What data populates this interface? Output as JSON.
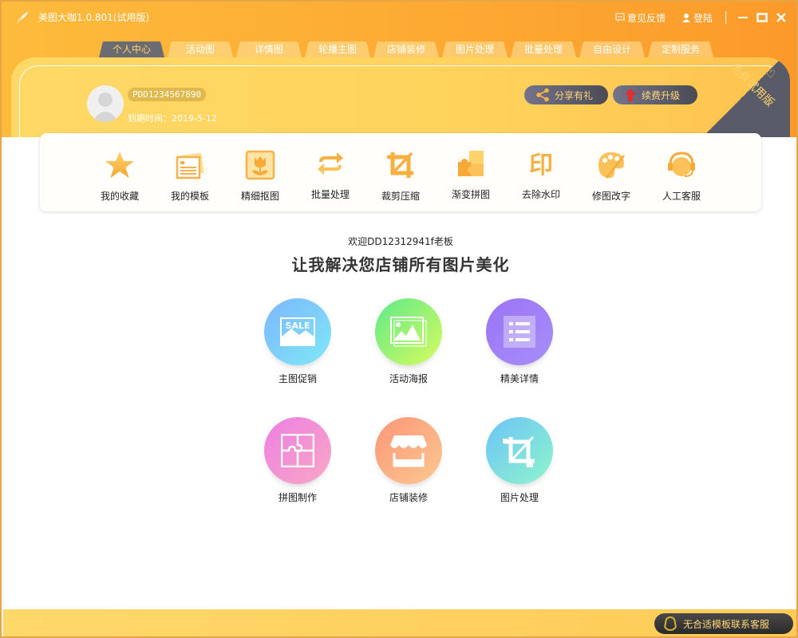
{
  "app": {
    "title": "美图大咖1.0.801(试用版)",
    "feedback_label": "意见反馈",
    "login_label": "登陆"
  },
  "tabs": [
    {
      "label": "个人中心",
      "active": true
    },
    {
      "label": "活动图",
      "active": false
    },
    {
      "label": "详情图",
      "active": false
    },
    {
      "label": "轮播主图",
      "active": false
    },
    {
      "label": "店铺装修",
      "active": false
    },
    {
      "label": "图片处理",
      "active": false
    },
    {
      "label": "批量处理",
      "active": false
    },
    {
      "label": "自由设计",
      "active": false
    },
    {
      "label": "定制服务",
      "active": false
    }
  ],
  "profile": {
    "user_id": "PDD1234567890",
    "expiry": "到期时间：2019-5-12",
    "share_label": "分享有礼",
    "upgrade_label": "续费升级",
    "ribbon_label": "免费试用版"
  },
  "tools": [
    {
      "label": "我的收藏",
      "icon": "star-icon"
    },
    {
      "label": "我的模板",
      "icon": "template-icon"
    },
    {
      "label": "精细抠图",
      "icon": "cutout-icon"
    },
    {
      "label": "批量处理",
      "icon": "batch-icon"
    },
    {
      "label": "裁剪压缩",
      "icon": "crop-icon"
    },
    {
      "label": "渐变拼图",
      "icon": "puzzle-icon"
    },
    {
      "label": "去除水印",
      "icon": "watermark-icon"
    },
    {
      "label": "修图改字",
      "icon": "palette-icon"
    },
    {
      "label": "人工客服",
      "icon": "headset-icon"
    }
  ],
  "main": {
    "welcome": "欢迎DD12312941f老板",
    "slogan": "让我解决您店铺所有图片美化"
  },
  "features": [
    {
      "label": "主图促销",
      "icon": "sale-icon",
      "badge": "SALE"
    },
    {
      "label": "活动海报",
      "icon": "poster-icon"
    },
    {
      "label": "精美详情",
      "icon": "detail-list-icon"
    },
    {
      "label": "拼图制作",
      "icon": "jigsaw-icon"
    },
    {
      "label": "店铺装修",
      "icon": "store-icon"
    },
    {
      "label": "图片处理",
      "icon": "image-crop-icon"
    }
  ],
  "footer": {
    "contact_label": "无合适模板联系客服"
  },
  "colors": {
    "brand_orange": "#fda832",
    "brand_yellow": "#ffd866",
    "dark_gray": "#5a5b68",
    "gold_text": "#ffd36b"
  }
}
